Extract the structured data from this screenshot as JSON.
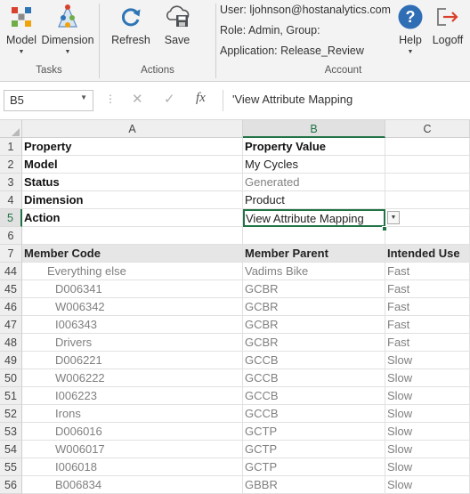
{
  "ribbon": {
    "tasks": {
      "model_label": "Model",
      "dimension_label": "Dimension",
      "group_label": "Tasks"
    },
    "actions": {
      "refresh_label": "Refresh",
      "save_label": "Save",
      "group_label": "Actions"
    },
    "account": {
      "user": "User: ljohnson@hostanalytics.com",
      "role": "Role: Admin, Group:",
      "application": "Application: Release_Review",
      "group_label": "Account"
    },
    "help_label": "Help",
    "logoff_label": "Logoff"
  },
  "formula_bar": {
    "name_box": "B5",
    "cancel_icon": "✕",
    "enter_icon": "✓",
    "fx_icon": "fx",
    "formula": "'View Attribute Mapping"
  },
  "columns": [
    "A",
    "B",
    "C"
  ],
  "rows": [
    {
      "n": "1",
      "a": "Property",
      "b": "Property Value",
      "c": ""
    },
    {
      "n": "2",
      "a": "Model",
      "b": "My Cycles",
      "c": ""
    },
    {
      "n": "3",
      "a": "Status",
      "b": "Generated",
      "c": ""
    },
    {
      "n": "4",
      "a": "Dimension",
      "b": "Product",
      "c": ""
    },
    {
      "n": "5",
      "a": "Action",
      "b": "View Attribute Mapping",
      "c": ""
    },
    {
      "n": "6",
      "a": "",
      "b": "",
      "c": ""
    },
    {
      "n": "7",
      "a": "Member Code",
      "b": "Member Parent",
      "c": "Intended Use"
    },
    {
      "n": "44",
      "a": "Everything else",
      "b": "Vadims Bike",
      "c": "Fast"
    },
    {
      "n": "45",
      "a": "D006341",
      "b": "GCBR",
      "c": "Fast"
    },
    {
      "n": "46",
      "a": "W006342",
      "b": "GCBR",
      "c": "Fast"
    },
    {
      "n": "47",
      "a": "I006343",
      "b": "GCBR",
      "c": "Fast"
    },
    {
      "n": "48",
      "a": "Drivers",
      "b": "GCBR",
      "c": "Fast"
    },
    {
      "n": "49",
      "a": "D006221",
      "b": "GCCB",
      "c": "Slow"
    },
    {
      "n": "50",
      "a": "W006222",
      "b": "GCCB",
      "c": "Slow"
    },
    {
      "n": "51",
      "a": "I006223",
      "b": "GCCB",
      "c": "Slow"
    },
    {
      "n": "52",
      "a": "Irons",
      "b": "GCCB",
      "c": "Slow"
    },
    {
      "n": "53",
      "a": "D006016",
      "b": "GCTP",
      "c": "Slow"
    },
    {
      "n": "54",
      "a": "W006017",
      "b": "GCTP",
      "c": "Slow"
    },
    {
      "n": "55",
      "a": "I006018",
      "b": "GCTP",
      "c": "Slow"
    },
    {
      "n": "56",
      "a": "B006834",
      "b": "GBBR",
      "c": "Slow"
    }
  ],
  "colors": {
    "excel_green": "#217346",
    "header_fill": "#e7e6e6",
    "help_blue": "#2f6db5",
    "refresh_blue": "#2e75b6",
    "logoff_red": "#d9412c"
  }
}
